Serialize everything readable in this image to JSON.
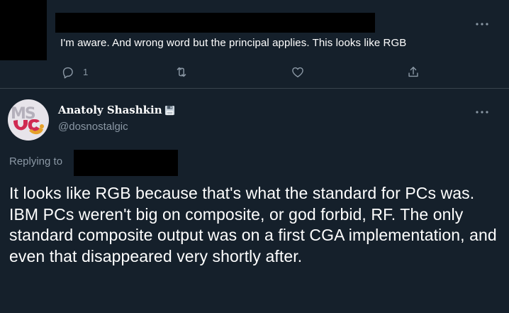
{
  "parent_tweet": {
    "text": "I'm aware. And wrong word but the principal applies. This looks like RGB",
    "actions": {
      "reply_count": "1"
    },
    "icons": [
      "more-icon",
      "reply-icon",
      "retweet-icon",
      "like-icon",
      "share-icon"
    ]
  },
  "tweet": {
    "author": {
      "name": "Anatoly Shashkin",
      "handle": "@dosnostalgic",
      "name_emoji": "floppy-disk-icon",
      "avatar_icon": "avatar-ms-logo"
    },
    "replying_to_label": "Replying to",
    "text": "It looks like RGB because that's what the standard for PCs was. IBM PCs weren't big on composite, or god forbid, RF. The only standard composite output was on a first CGA implementation, and even that disappeared very shortly after."
  },
  "colors": {
    "background": "#15202b",
    "text_primary": "#ffffff",
    "text_secondary": "#8b98a5",
    "divider": "#38444d",
    "redaction": "#000000"
  }
}
